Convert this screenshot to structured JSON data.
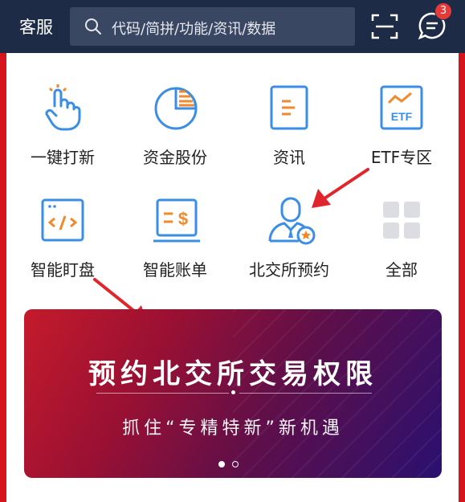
{
  "header": {
    "service_label": "客服",
    "search_placeholder": "代码/简拼/功能/资讯/数据",
    "message_badge": "3"
  },
  "grid": [
    {
      "label": "一键打新",
      "icon": "tap-hand-icon"
    },
    {
      "label": "资金股份",
      "icon": "pie-chart-icon"
    },
    {
      "label": "资讯",
      "icon": "document-icon"
    },
    {
      "label": "ETF专区",
      "icon": "etf-chart-icon"
    },
    {
      "label": "智能盯盘",
      "icon": "code-screen-icon"
    },
    {
      "label": "智能账单",
      "icon": "bill-icon"
    },
    {
      "label": "北交所预约",
      "icon": "user-badge-icon"
    },
    {
      "label": "全部",
      "icon": "all-grid-icon"
    }
  ],
  "banner": {
    "title": "预约北交所交易权限",
    "subtitle": "抓住“专精特新”新机遇"
  },
  "colors": {
    "header_bg": "#1e2b46",
    "icon_blue": "#3a8ee6",
    "icon_orange": "#f08a2c",
    "arrow_red": "#e0262c"
  }
}
